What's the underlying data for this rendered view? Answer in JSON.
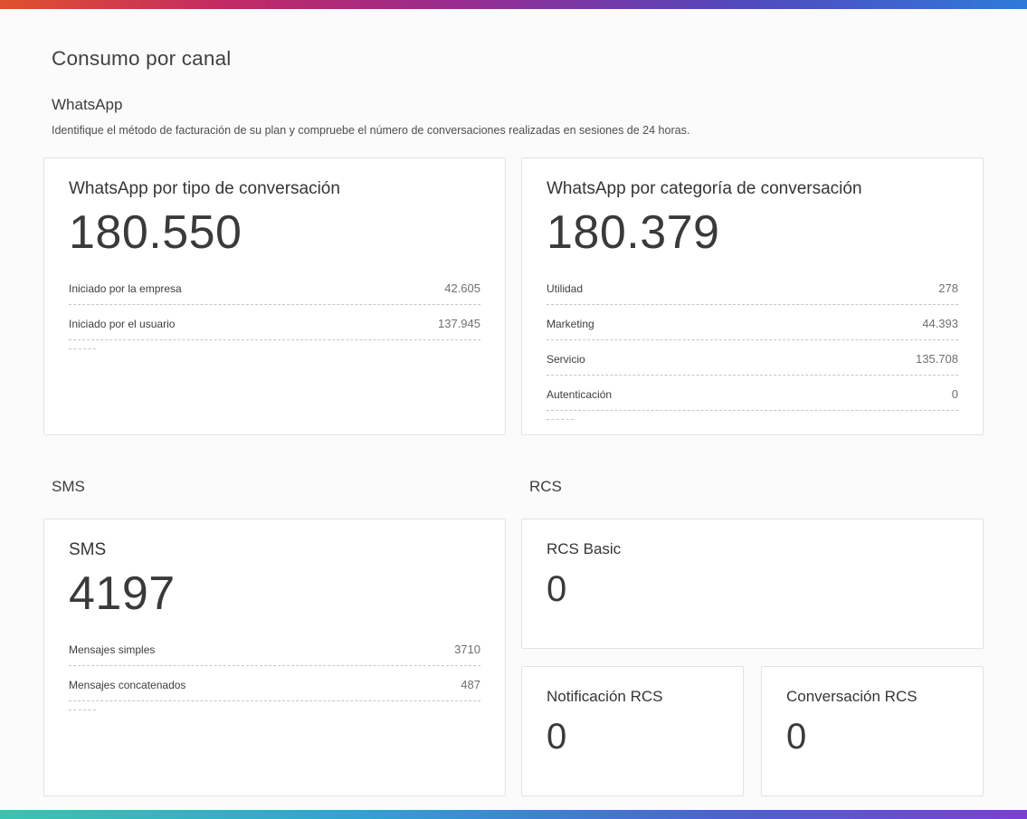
{
  "page": {
    "title": "Consumo por canal"
  },
  "colors": {
    "top_bar_gradient": [
      "#e0512d",
      "#c22a63",
      "#972b90",
      "#5248bd",
      "#2d7bd8"
    ],
    "bottom_bar_gradient": [
      "#3cc3ae",
      "#2fa3d3",
      "#4b62d2",
      "#7b3fd6"
    ],
    "card_border": "#e3e3e3",
    "dashed_divider": "#c6c6c6",
    "background": "#fbfbfb",
    "text_primary": "#3d3d3d",
    "text_secondary": "#6f6f6f"
  },
  "sections": {
    "whatsapp": {
      "heading": "WhatsApp",
      "description": "Identifique el método de facturación de su plan y compruebe el número de conversaciones realizadas en sesiones de 24 horas."
    },
    "sms": {
      "heading": "SMS"
    },
    "rcs": {
      "heading": "RCS"
    }
  },
  "cards": {
    "whatsapp_tipo": {
      "title": "WhatsApp por tipo de conversación",
      "total": "180.550",
      "rows": [
        {
          "label": "Iniciado por la empresa",
          "value": "42.605"
        },
        {
          "label": "Iniciado por el usuario",
          "value": "137.945"
        }
      ]
    },
    "whatsapp_categoria": {
      "title": "WhatsApp por categoría de conversación",
      "total": "180.379",
      "rows": [
        {
          "label": "Utilidad",
          "value": "278"
        },
        {
          "label": "Marketing",
          "value": "44.393"
        },
        {
          "label": "Servicio",
          "value": "135.708"
        },
        {
          "label": "Autenticación",
          "value": "0"
        }
      ]
    },
    "sms": {
      "title": "SMS",
      "total": "4197",
      "rows": [
        {
          "label": "Mensajes simples",
          "value": "3710"
        },
        {
          "label": "Mensajes concatenados",
          "value": "487"
        }
      ]
    },
    "rcs_basic": {
      "title": "RCS Basic",
      "total": "0"
    },
    "rcs_notificacion": {
      "title": "Notificación RCS",
      "total": "0"
    },
    "rcs_conversacion": {
      "title": "Conversación RCS",
      "total": "0"
    }
  }
}
